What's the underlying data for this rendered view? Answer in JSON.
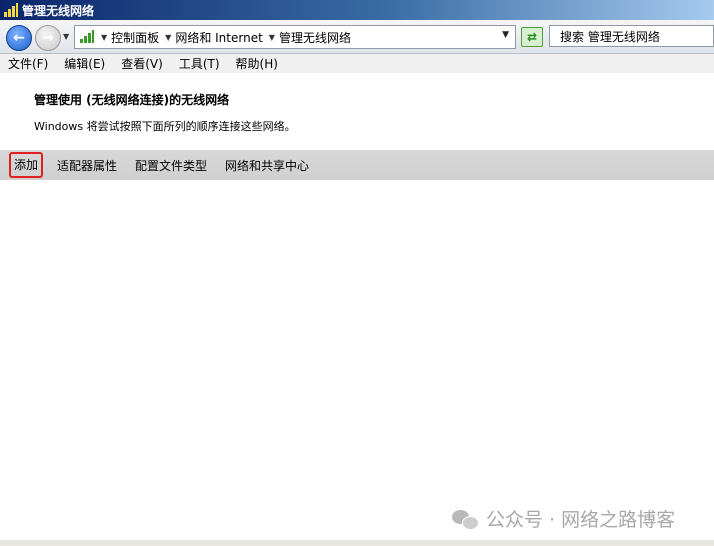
{
  "window": {
    "title": "管理无线网络"
  },
  "address": {
    "crumbs": [
      "控制面板",
      "网络和 Internet",
      "管理无线网络"
    ],
    "search_placeholder": "搜索 管理无线网络"
  },
  "menu": [
    "文件(F)",
    "编辑(E)",
    "查看(V)",
    "工具(T)",
    "帮助(H)"
  ],
  "content": {
    "heading": "管理使用 (无线网络连接)的无线网络",
    "description": "Windows 将尝试按照下面所列的顺序连接这些网络。"
  },
  "commands": {
    "add": "添加",
    "adapter_properties": "适配器属性",
    "profile_types": "配置文件类型",
    "network_center": "网络和共享中心"
  },
  "watermark": "公众号 · 网络之路博客",
  "colors": {
    "highlight_border": "#e02020",
    "titlebar": "#0a246a"
  }
}
